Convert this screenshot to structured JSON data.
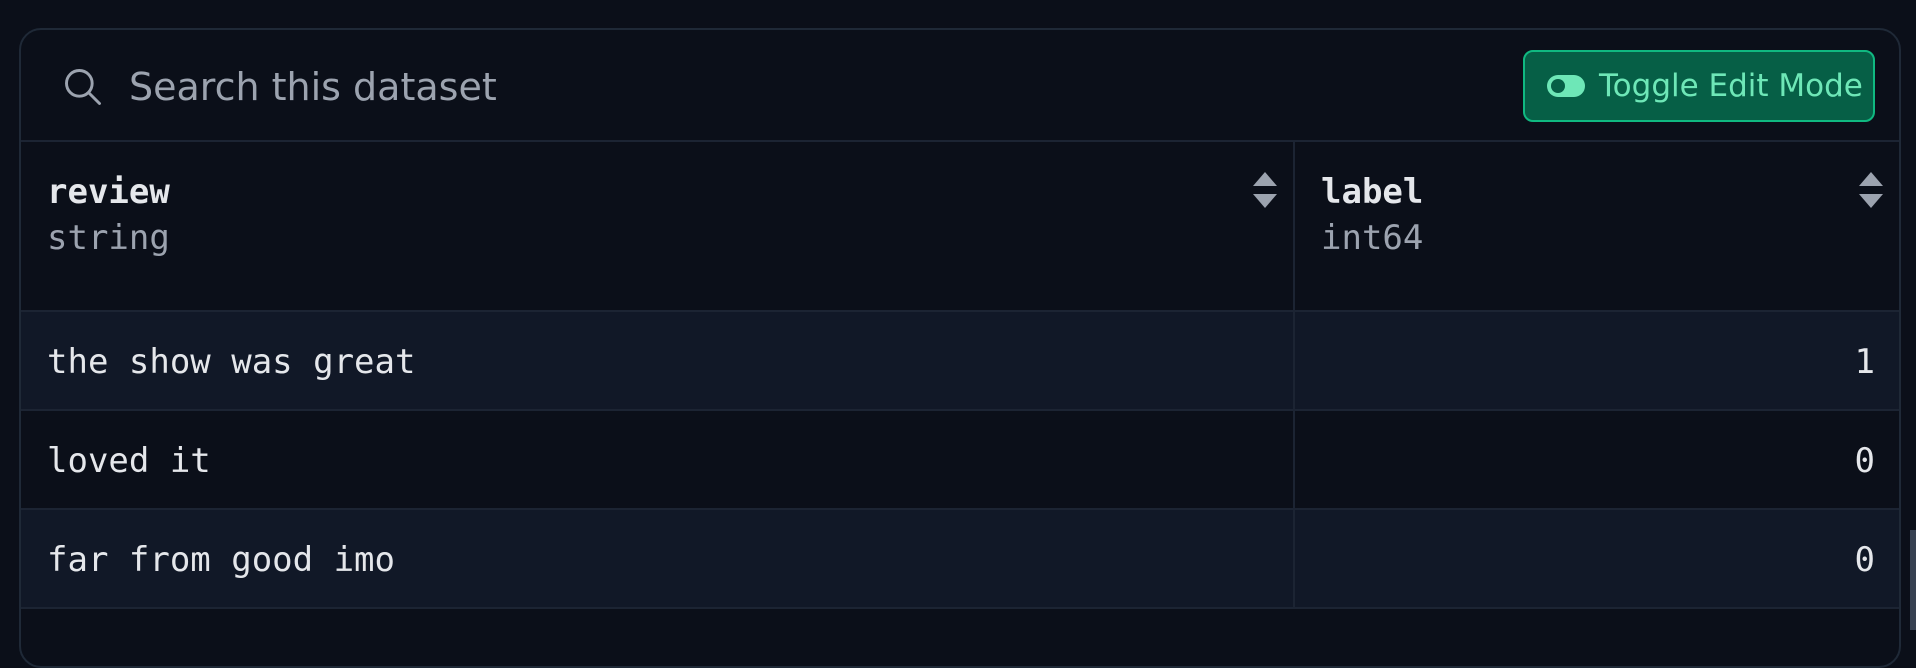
{
  "search": {
    "placeholder": "Search this dataset",
    "icon": "search-icon"
  },
  "toolbar": {
    "toggle_label": "Toggle Edit Mode",
    "toggle_icon": "toggle-icon",
    "toggle_color": "#065f46",
    "toggle_text_color": "#6ee7b7"
  },
  "table": {
    "columns": [
      {
        "name": "review",
        "type": "string"
      },
      {
        "name": "label",
        "type": "int64"
      }
    ],
    "rows": [
      {
        "review": "the show was great",
        "label": "1"
      },
      {
        "review": "loved it",
        "label": "0"
      },
      {
        "review": "far from good imo",
        "label": "0"
      }
    ]
  },
  "colors": {
    "background": "#0b0f19",
    "row_alt": "#111827",
    "border": "#1c2433",
    "text": "#e5e7eb",
    "muted": "#9ca3af"
  }
}
